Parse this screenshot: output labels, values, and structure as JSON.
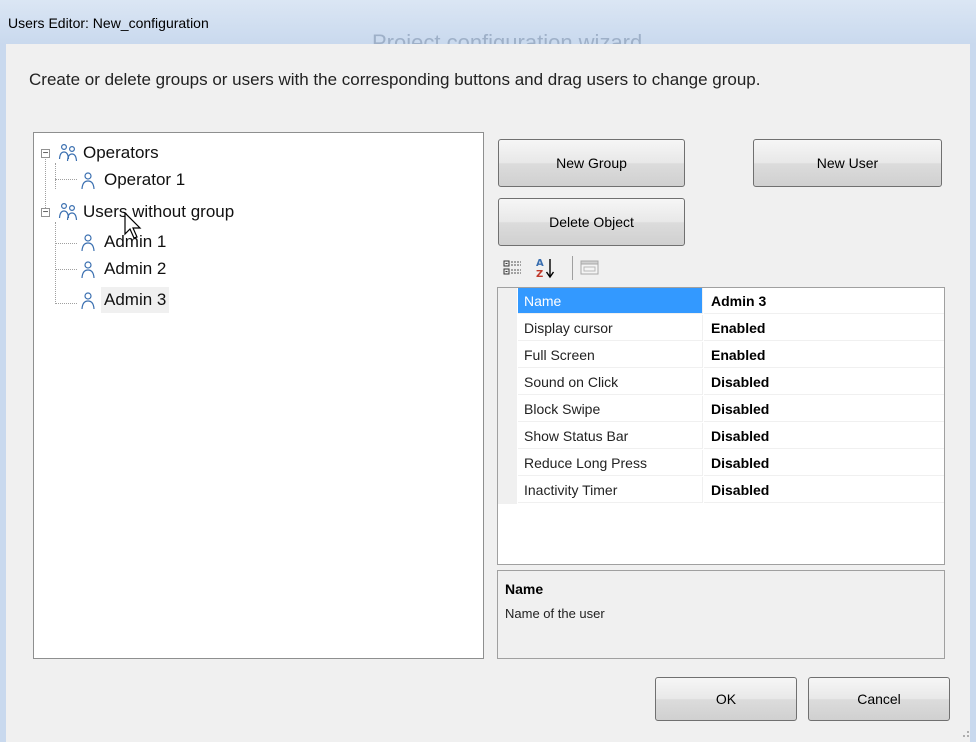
{
  "window": {
    "title": "Users Editor: New_configuration",
    "background_title": "Project configuration wizard"
  },
  "instructions": "Create or delete groups or users with the corresponding buttons and drag users to change group.",
  "tree": {
    "groups": [
      {
        "label": "Operators",
        "icon": "group-icon",
        "expanded": true,
        "users": [
          {
            "label": "Operator 1",
            "icon": "user-icon"
          }
        ]
      },
      {
        "label": "Users without group",
        "icon": "group-icon",
        "expanded": true,
        "users": [
          {
            "label": "Admin 1",
            "icon": "user-icon"
          },
          {
            "label": "Admin 2",
            "icon": "user-icon"
          },
          {
            "label": "Admin 3",
            "icon": "user-icon",
            "selected": true
          }
        ]
      }
    ]
  },
  "buttons": {
    "new_group": "New Group",
    "new_user": "New User",
    "delete_object": "Delete Object",
    "ok": "OK",
    "cancel": "Cancel"
  },
  "toolbar": {
    "categorized": "categorized-view-icon",
    "alphabetical": "sort-alphabetical-icon",
    "property_pages": "property-pages-icon"
  },
  "properties": [
    {
      "name": "Name",
      "value": "Admin 3",
      "selected": true
    },
    {
      "name": "Display cursor",
      "value": "Enabled"
    },
    {
      "name": "Full Screen",
      "value": "Enabled"
    },
    {
      "name": "Sound on Click",
      "value": "Disabled"
    },
    {
      "name": "Block Swipe",
      "value": "Disabled"
    },
    {
      "name": "Show Status Bar",
      "value": "Disabled"
    },
    {
      "name": "Reduce Long Press",
      "value": "Disabled"
    },
    {
      "name": "Inactivity Timer",
      "value": "Disabled"
    }
  ],
  "help": {
    "title": "Name",
    "description": "Name of the user"
  },
  "colors": {
    "selection": "#3399ff",
    "icon_blue": "#3a6fb0"
  }
}
